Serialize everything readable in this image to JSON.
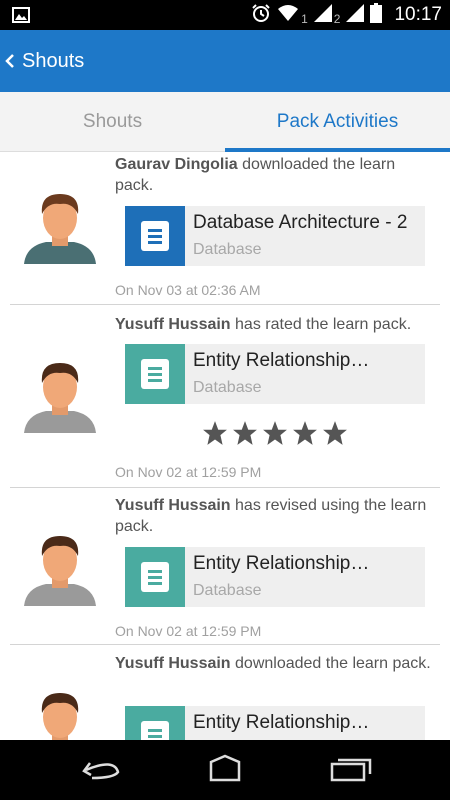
{
  "status_bar": {
    "time": "10:17",
    "sim1": "1",
    "sim2": "2"
  },
  "app_bar": {
    "title": "Shouts"
  },
  "tabs": [
    {
      "label": "Shouts",
      "active": false
    },
    {
      "label": "Pack Activities",
      "active": true
    }
  ],
  "feed": [
    {
      "user": "Gaurav Dingolia",
      "action": " downloaded the learn pack.",
      "pack_title": "Database Architecture - 2",
      "pack_category": "Database",
      "timestamp": "On Nov 03 at 02:36 AM",
      "icon_color": "#1e6fb8"
    },
    {
      "user": "Yusuff Hussain",
      "action": " has rated the learn pack.",
      "pack_title": "Entity Relationship…",
      "pack_category": "Database",
      "rating": 5,
      "timestamp": "On Nov 02 at 12:59 PM",
      "icon_color": "#4aaba0"
    },
    {
      "user": "Yusuff Hussain",
      "action": " has revised using the learn pack.",
      "pack_title": "Entity Relationship…",
      "pack_category": "Database",
      "timestamp": "On Nov 02 at 12:59 PM",
      "icon_color": "#4aaba0"
    },
    {
      "user": "Yusuff Hussain",
      "action": " downloaded the learn pack.",
      "pack_title": "Entity Relationship…",
      "pack_category": "",
      "timestamp": "",
      "icon_color": "#4aaba0"
    }
  ],
  "colors": {
    "accent": "#1e78c8",
    "status_bar": "#000000",
    "nav_bar": "#000000"
  }
}
